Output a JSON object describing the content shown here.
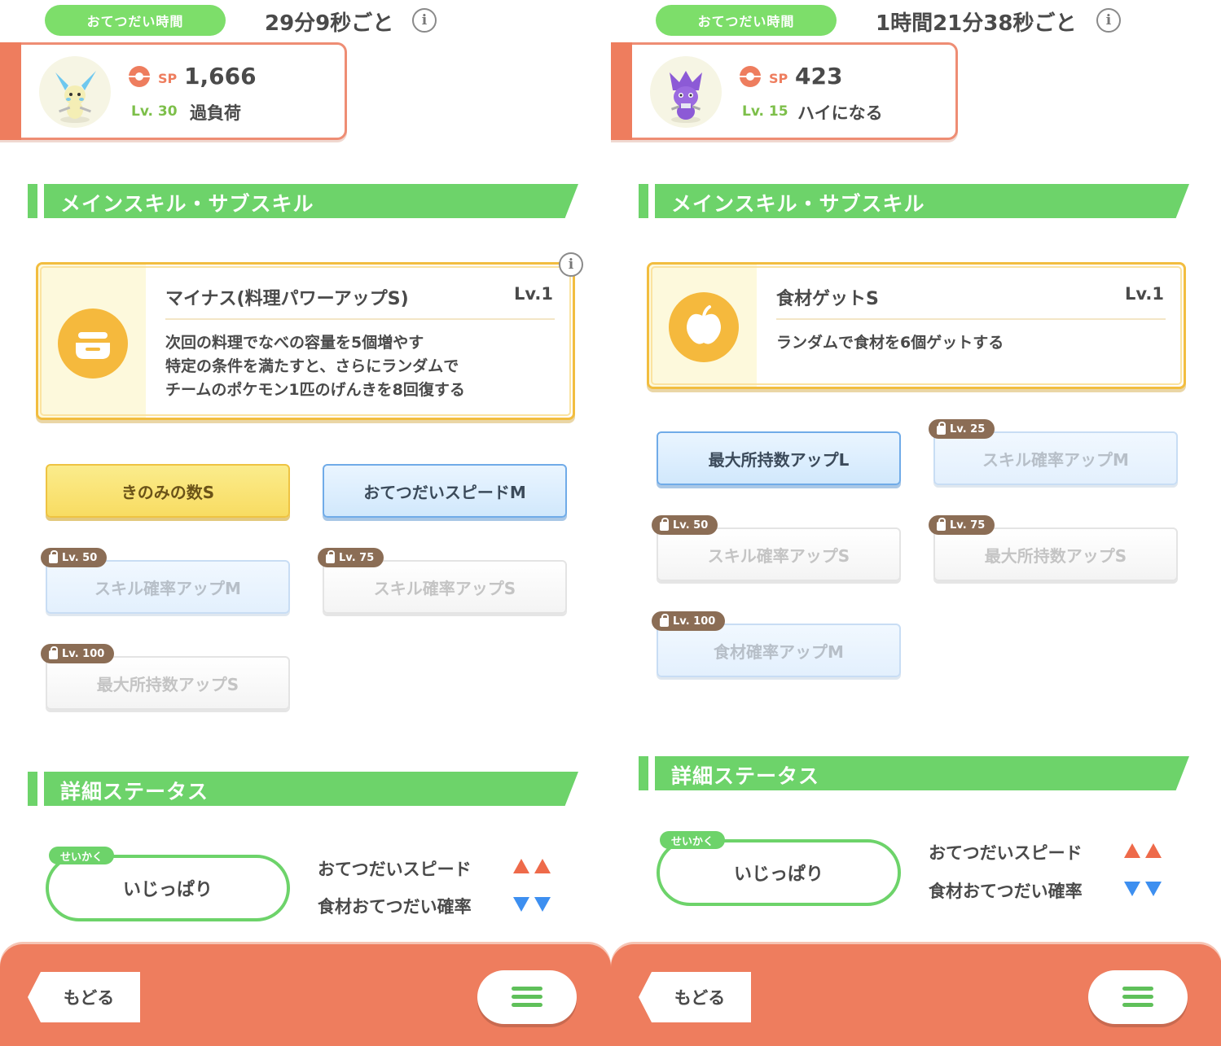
{
  "panels": [
    {
      "help_time": {
        "label": "おてつだい時間",
        "value": "29分9秒ごと"
      },
      "pokemon": {
        "sp_label": "SP",
        "sp_value": "1,666",
        "level": "Lv. 30",
        "status": "過負荷",
        "avatar_icon": "minun-sprite"
      },
      "main_section_title": "メインスキル・サブスキル",
      "main_skill": {
        "name": "マイナス(料理パワーアップS)",
        "level": "Lv.1",
        "icon": "pot-icon",
        "description": [
          "次回の料理でなべの容量を5個増やす",
          "特定の条件を満たすと、さらにランダムで",
          "チームのポケモン1匹のげんきを8回復する"
        ]
      },
      "sub_skills": [
        {
          "label": "きのみの数S",
          "style": "gold",
          "lock": ""
        },
        {
          "label": "おてつだいスピードM",
          "style": "blue",
          "lock": ""
        },
        {
          "label": "スキル確率アップM",
          "style": "locked-blue",
          "lock": "Lv. 50"
        },
        {
          "label": "スキル確率アップS",
          "style": "locked-white",
          "lock": "Lv. 75"
        },
        {
          "label": "最大所持数アップS",
          "style": "locked-white",
          "lock": "Lv. 100"
        }
      ],
      "status_section_title": "詳細ステータス",
      "nature": {
        "tag": "せいかく",
        "name": "いじっぱり",
        "up_label": "おてつだいスピード",
        "down_label": "食材おてつだい確率"
      },
      "nav": {
        "back": "もどる",
        "menu_icon": "hamburger-icon"
      }
    },
    {
      "help_time": {
        "label": "おてつだい時間",
        "value": "1時間21分38秒ごと"
      },
      "pokemon": {
        "sp_label": "SP",
        "sp_value": "423",
        "level": "Lv. 15",
        "status": "ハイになる",
        "avatar_icon": "toxel-sprite"
      },
      "main_section_title": "メインスキル・サブスキル",
      "main_skill": {
        "name": "食材ゲットS",
        "level": "Lv.1",
        "icon": "apple-icon",
        "description": [
          "ランダムで食材を6個ゲットする"
        ]
      },
      "sub_skills": [
        {
          "label": "最大所持数アップL",
          "style": "blue",
          "lock": ""
        },
        {
          "label": "スキル確率アップM",
          "style": "locked-blue",
          "lock": "Lv. 25"
        },
        {
          "label": "スキル確率アップS",
          "style": "locked-white",
          "lock": "Lv. 50"
        },
        {
          "label": "最大所持数アップS",
          "style": "locked-white",
          "lock": "Lv. 75"
        },
        {
          "label": "食材確率アップM",
          "style": "locked-blue",
          "lock": "Lv. 100"
        }
      ],
      "status_section_title": "詳細ステータス",
      "nature": {
        "tag": "せいかく",
        "name": "いじっぱり",
        "up_label": "おてつだいスピード",
        "down_label": "食材おてつだい確率"
      },
      "nav": {
        "back": "もどる",
        "menu_icon": "hamburger-icon"
      }
    }
  ],
  "colors": {
    "accent_green": "#6dd36a",
    "accent_orange": "#ee7d5e",
    "skill_gold": "#f2bd3f",
    "up_arrow": "#ee6a4a",
    "down_arrow": "#3d8ff0"
  }
}
